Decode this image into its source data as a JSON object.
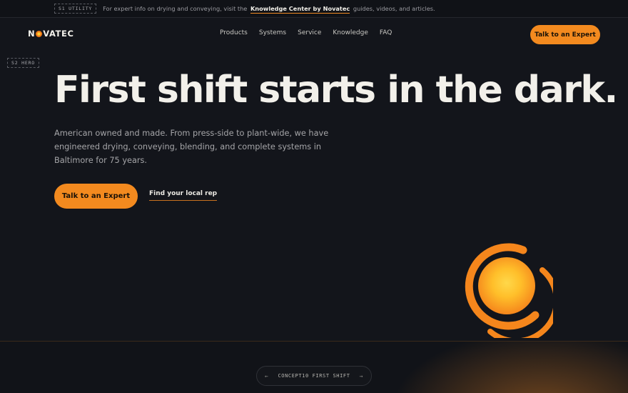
{
  "utility": {
    "tag": "S1 UTILITY",
    "text_before": "For expert info on drying and conveying, visit the",
    "link": "Knowledge Center by Novatec",
    "text_after": "guides, videos, and articles."
  },
  "nav": {
    "logo_left": "N",
    "logo_right": "VATEC",
    "links": [
      "Products",
      "Systems",
      "Service",
      "Knowledge",
      "FAQ"
    ],
    "cta": "Talk to an Expert"
  },
  "hero": {
    "tag": "S2 HERO",
    "headline": "First shift starts in the dark.",
    "lede": "American owned and made. From press-side to plant-wide, we have engineered drying, conveying, blending, and complete systems in Baltimore for 75 years.",
    "primary_cta": "Talk to an Expert",
    "secondary_cta": "Find your local rep"
  },
  "concept_switcher": {
    "prev": "←",
    "label": "CONCEPT10 FIRST SHIFT",
    "next": "→"
  },
  "colors": {
    "background": "#13151b",
    "accent": "#f38a1f",
    "sun_core": "#ffcc33"
  },
  "icons": {
    "logo_o": "sun-dot-icon",
    "hero_graphic": "sun-ring-icon"
  }
}
